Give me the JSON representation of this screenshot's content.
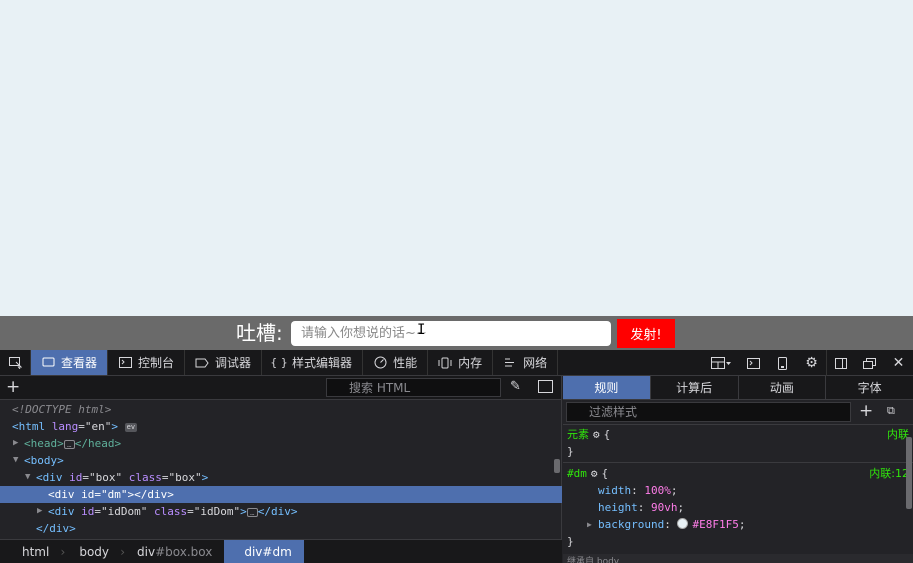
{
  "page": {
    "bar": {
      "label": "吐槽:",
      "input_placeholder": "请输入你想说的话~~",
      "send_label": "发射!"
    }
  },
  "devtools": {
    "tabs": [
      {
        "label": "查看器",
        "icon": "inspector-icon",
        "active": true
      },
      {
        "label": "控制台",
        "icon": "console-icon"
      },
      {
        "label": "调试器",
        "icon": "debugger-icon"
      },
      {
        "label": "样式编辑器",
        "icon": "style-editor-icon",
        "glyph": "{ }"
      },
      {
        "label": "性能",
        "icon": "performance-icon"
      },
      {
        "label": "内存",
        "icon": "memory-icon"
      },
      {
        "label": "网络",
        "icon": "network-icon"
      }
    ],
    "inspector": {
      "search_placeholder": "搜索 HTML",
      "tree": {
        "doctype": "<!DOCTYPE html>",
        "html_open": "<html",
        "html_lang_attr": "lang",
        "html_lang_val": "\"en\"",
        "html_close": ">",
        "html_badge": "ev",
        "head": "<head>",
        "head_close": "</head>",
        "head_badge": "…",
        "body": "<body>",
        "box_open": "<div",
        "box_id_attr": "id",
        "box_id_val": "\"box\"",
        "box_class_attr": "class",
        "box_class_val": "\"box\"",
        "box_close": ">",
        "dm_line": "<div id=\"dm\"></div>",
        "iddom_open": "<div",
        "iddom_id_attr": "id",
        "iddom_id_val": "\"idDom\"",
        "iddom_class_attr": "class",
        "iddom_class_val": "\"idDom\"",
        "iddom_gt": ">",
        "iddom_badge": "…",
        "iddom_close": "</div>",
        "div_close": "</div>"
      },
      "breadcrumbs": [
        {
          "tag": "html",
          "rest": ""
        },
        {
          "tag": "body",
          "rest": ""
        },
        {
          "tag": "div",
          "rest": "#box.box"
        },
        {
          "tag": "div",
          "rest": "#dm",
          "active": true
        }
      ]
    },
    "rules": {
      "tabs": [
        "规则",
        "计算后",
        "动画",
        "字体"
      ],
      "filter_placeholder": "过滤样式",
      "element_selector": "元素",
      "element_source": "内联",
      "brace_open": "{",
      "brace_close": "}",
      "dm_selector": "#dm",
      "dm_source": "内联:12",
      "props": [
        {
          "name": "width",
          "value": "100%"
        },
        {
          "name": "height",
          "value": "90vh"
        },
        {
          "name": "background",
          "value": "#E8F1F5"
        }
      ],
      "bottom_text": "继承自 body"
    }
  },
  "colors": {
    "page_bg": "#E8F1F5",
    "bar_bg": "#6a6a6a",
    "send_bg": "#ff0000",
    "accent": "#4e6fae"
  }
}
